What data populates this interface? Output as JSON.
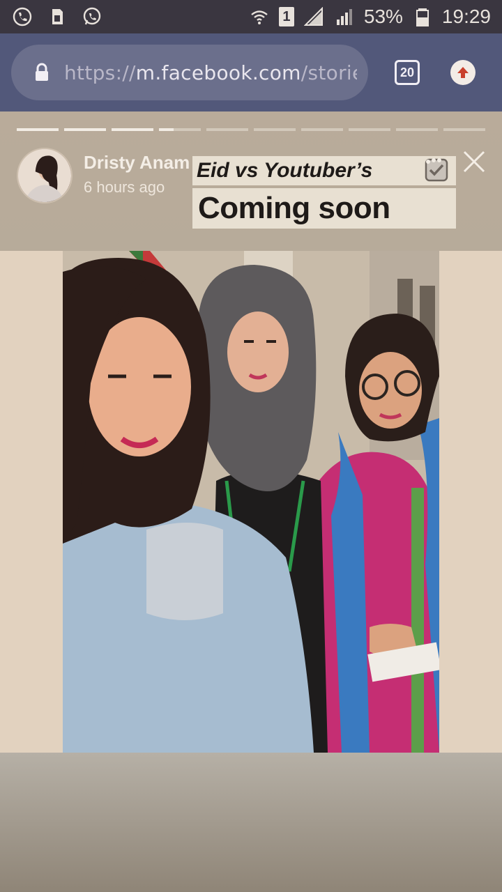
{
  "status_bar": {
    "icons": [
      "phone-icon",
      "sim-card-icon",
      "whatsapp-icon",
      "wifi-icon",
      "signal-icon"
    ],
    "sim_slot": "1",
    "battery": "53%",
    "time": "19:29"
  },
  "browser": {
    "url_protocol": "https://",
    "url_host": "m.facebook.com",
    "url_path": "/storie",
    "tab_count": "20"
  },
  "story": {
    "progress": [
      1,
      1,
      1,
      0.35,
      0,
      0,
      0,
      0,
      0,
      0
    ],
    "author": "Dristy Anam",
    "time_ago": "6 hours ago",
    "caption_line1": "Eid vs Youtuber’s",
    "caption_line2": "Coming soon"
  }
}
